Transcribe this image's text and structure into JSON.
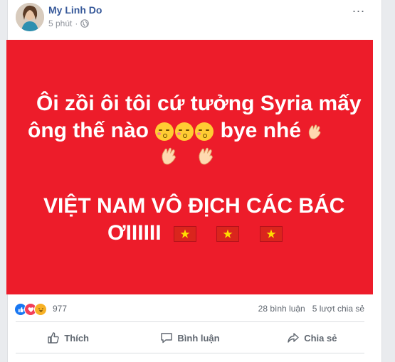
{
  "post": {
    "author": "My Linh Do",
    "time": "5 phút",
    "privacy_icon": "globe-icon",
    "more_label": "..."
  },
  "banner": {
    "background": "#ed1c2a",
    "line1": "Ôi zồi ôi tôi cứ tưởng Syria mấy",
    "line2a": "ông thế nào",
    "line2b": "bye nhé",
    "line4": "VIỆT NAM VÔ ĐỊCH CÁC BÁC",
    "line5": "ƠIIIIII",
    "emoji_kiss_count": 3,
    "emoji_wave_count": 3,
    "flag_count": 3
  },
  "reactions": {
    "icons": [
      "like-icon",
      "love-icon",
      "haha-icon"
    ],
    "count": "977",
    "comments": "28 bình luận",
    "shares": "5 lượt chia sẻ"
  },
  "actions": {
    "like": "Thích",
    "comment": "Bình luận",
    "share": "Chia sẻ"
  },
  "colors": {
    "link": "#365899",
    "like_blue": "#1877f2",
    "love_red": "#f33e58",
    "haha_yellow": "#f7b125"
  }
}
